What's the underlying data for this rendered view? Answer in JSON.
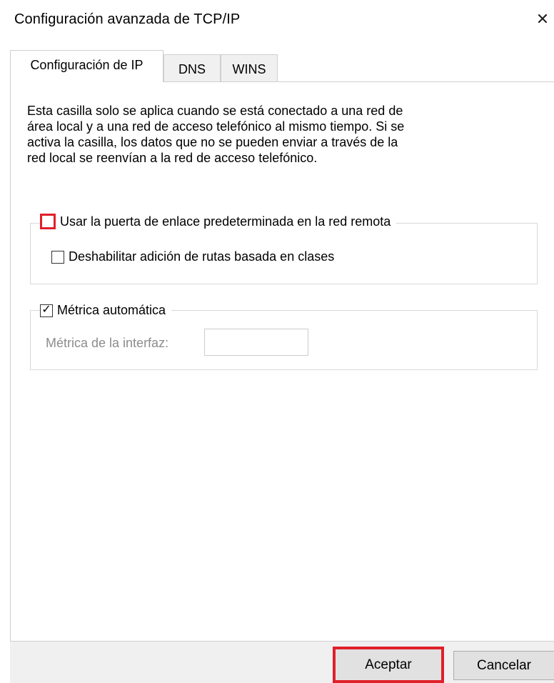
{
  "window": {
    "title": "Configuración avanzada de TCP/IP",
    "close_symbol": "✕"
  },
  "tabs": [
    {
      "label": "Configuración de IP",
      "selected": true
    },
    {
      "label": "DNS",
      "selected": false
    },
    {
      "label": "WINS",
      "selected": false
    }
  ],
  "description": {
    "lines": [
      "Esta casilla solo se aplica cuando se está conectado a una red de",
      "área local y a una red de acceso telefónico al mismo tiempo. Si se",
      "activa la casilla, los datos que no se pueden enviar a través de la",
      "red local se reenvían a la red de acceso telefónico."
    ]
  },
  "gateway_group": {
    "use_default_gateway": {
      "label": "Usar la puerta de enlace predeterminada en la red remota",
      "checked": false
    },
    "disable_class_routes": {
      "label": "Deshabilitar adición de rutas basada en clases",
      "checked": false
    }
  },
  "metric_group": {
    "automatic_metric": {
      "label": "Métrica automática",
      "checked": true,
      "check_symbol": "✓"
    },
    "interface_metric": {
      "label": "Métrica de la interfaz:",
      "value": ""
    }
  },
  "buttons": {
    "ok": "Aceptar",
    "cancel": "Cancelar"
  },
  "colors": {
    "highlight": "#e0202a",
    "disabled_text": "#8c8c8c"
  }
}
